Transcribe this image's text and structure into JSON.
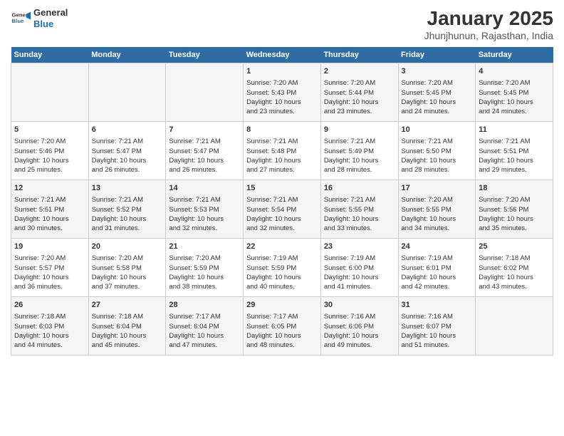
{
  "logo": {
    "line1": "General",
    "line2": "Blue"
  },
  "title": "January 2025",
  "subtitle": "Jhunjhunun, Rajasthan, India",
  "days_of_week": [
    "Sunday",
    "Monday",
    "Tuesday",
    "Wednesday",
    "Thursday",
    "Friday",
    "Saturday"
  ],
  "weeks": [
    [
      {
        "day": "",
        "info": ""
      },
      {
        "day": "",
        "info": ""
      },
      {
        "day": "",
        "info": ""
      },
      {
        "day": "1",
        "info": "Sunrise: 7:20 AM\nSunset: 5:43 PM\nDaylight: 10 hours\nand 23 minutes."
      },
      {
        "day": "2",
        "info": "Sunrise: 7:20 AM\nSunset: 5:44 PM\nDaylight: 10 hours\nand 23 minutes."
      },
      {
        "day": "3",
        "info": "Sunrise: 7:20 AM\nSunset: 5:45 PM\nDaylight: 10 hours\nand 24 minutes."
      },
      {
        "day": "4",
        "info": "Sunrise: 7:20 AM\nSunset: 5:45 PM\nDaylight: 10 hours\nand 24 minutes."
      }
    ],
    [
      {
        "day": "5",
        "info": "Sunrise: 7:20 AM\nSunset: 5:46 PM\nDaylight: 10 hours\nand 25 minutes."
      },
      {
        "day": "6",
        "info": "Sunrise: 7:21 AM\nSunset: 5:47 PM\nDaylight: 10 hours\nand 26 minutes."
      },
      {
        "day": "7",
        "info": "Sunrise: 7:21 AM\nSunset: 5:47 PM\nDaylight: 10 hours\nand 26 minutes."
      },
      {
        "day": "8",
        "info": "Sunrise: 7:21 AM\nSunset: 5:48 PM\nDaylight: 10 hours\nand 27 minutes."
      },
      {
        "day": "9",
        "info": "Sunrise: 7:21 AM\nSunset: 5:49 PM\nDaylight: 10 hours\nand 28 minutes."
      },
      {
        "day": "10",
        "info": "Sunrise: 7:21 AM\nSunset: 5:50 PM\nDaylight: 10 hours\nand 28 minutes."
      },
      {
        "day": "11",
        "info": "Sunrise: 7:21 AM\nSunset: 5:51 PM\nDaylight: 10 hours\nand 29 minutes."
      }
    ],
    [
      {
        "day": "12",
        "info": "Sunrise: 7:21 AM\nSunset: 5:51 PM\nDaylight: 10 hours\nand 30 minutes."
      },
      {
        "day": "13",
        "info": "Sunrise: 7:21 AM\nSunset: 5:52 PM\nDaylight: 10 hours\nand 31 minutes."
      },
      {
        "day": "14",
        "info": "Sunrise: 7:21 AM\nSunset: 5:53 PM\nDaylight: 10 hours\nand 32 minutes."
      },
      {
        "day": "15",
        "info": "Sunrise: 7:21 AM\nSunset: 5:54 PM\nDaylight: 10 hours\nand 32 minutes."
      },
      {
        "day": "16",
        "info": "Sunrise: 7:21 AM\nSunset: 5:55 PM\nDaylight: 10 hours\nand 33 minutes."
      },
      {
        "day": "17",
        "info": "Sunrise: 7:20 AM\nSunset: 5:55 PM\nDaylight: 10 hours\nand 34 minutes."
      },
      {
        "day": "18",
        "info": "Sunrise: 7:20 AM\nSunset: 5:56 PM\nDaylight: 10 hours\nand 35 minutes."
      }
    ],
    [
      {
        "day": "19",
        "info": "Sunrise: 7:20 AM\nSunset: 5:57 PM\nDaylight: 10 hours\nand 36 minutes."
      },
      {
        "day": "20",
        "info": "Sunrise: 7:20 AM\nSunset: 5:58 PM\nDaylight: 10 hours\nand 37 minutes."
      },
      {
        "day": "21",
        "info": "Sunrise: 7:20 AM\nSunset: 5:59 PM\nDaylight: 10 hours\nand 38 minutes."
      },
      {
        "day": "22",
        "info": "Sunrise: 7:19 AM\nSunset: 5:59 PM\nDaylight: 10 hours\nand 40 minutes."
      },
      {
        "day": "23",
        "info": "Sunrise: 7:19 AM\nSunset: 6:00 PM\nDaylight: 10 hours\nand 41 minutes."
      },
      {
        "day": "24",
        "info": "Sunrise: 7:19 AM\nSunset: 6:01 PM\nDaylight: 10 hours\nand 42 minutes."
      },
      {
        "day": "25",
        "info": "Sunrise: 7:18 AM\nSunset: 6:02 PM\nDaylight: 10 hours\nand 43 minutes."
      }
    ],
    [
      {
        "day": "26",
        "info": "Sunrise: 7:18 AM\nSunset: 6:03 PM\nDaylight: 10 hours\nand 44 minutes."
      },
      {
        "day": "27",
        "info": "Sunrise: 7:18 AM\nSunset: 6:04 PM\nDaylight: 10 hours\nand 45 minutes."
      },
      {
        "day": "28",
        "info": "Sunrise: 7:17 AM\nSunset: 6:04 PM\nDaylight: 10 hours\nand 47 minutes."
      },
      {
        "day": "29",
        "info": "Sunrise: 7:17 AM\nSunset: 6:05 PM\nDaylight: 10 hours\nand 48 minutes."
      },
      {
        "day": "30",
        "info": "Sunrise: 7:16 AM\nSunset: 6:06 PM\nDaylight: 10 hours\nand 49 minutes."
      },
      {
        "day": "31",
        "info": "Sunrise: 7:16 AM\nSunset: 6:07 PM\nDaylight: 10 hours\nand 51 minutes."
      },
      {
        "day": "",
        "info": ""
      }
    ]
  ]
}
